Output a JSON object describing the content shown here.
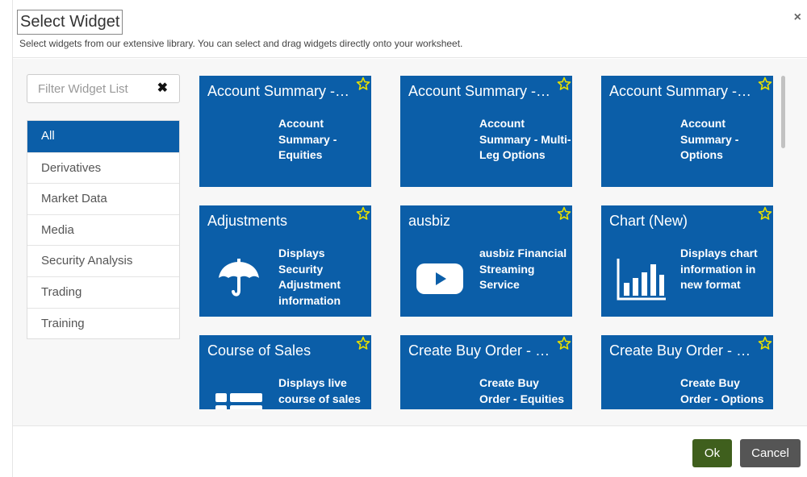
{
  "dialog": {
    "title": "Select Widget",
    "subtitle": "Select widgets from our extensive library. You can select and drag widgets directly onto your worksheet.",
    "close_glyph": "×"
  },
  "filter": {
    "placeholder": "Filter Widget List",
    "clear_glyph": "✖"
  },
  "categories": [
    {
      "label": "All",
      "active": true
    },
    {
      "label": "Derivatives"
    },
    {
      "label": "Market Data"
    },
    {
      "label": "Media"
    },
    {
      "label": "Security Analysis"
    },
    {
      "label": "Trading"
    },
    {
      "label": "Training"
    }
  ],
  "widgets": [
    {
      "title": "Account Summary - Equities",
      "desc": "Account Summary - Equities",
      "icon": "none"
    },
    {
      "title": "Account Summary - Multi-Leg Options",
      "desc": "Account Summary - Multi-Leg Options",
      "icon": "none"
    },
    {
      "title": "Account Summary - Options",
      "desc": "Account Summary - Options",
      "icon": "none"
    },
    {
      "title": "Adjustments",
      "desc": "Displays Security Adjustment information",
      "icon": "umbrella-icon"
    },
    {
      "title": "ausbiz",
      "desc": "ausbiz Financial Streaming Service",
      "icon": "youtube-play-icon"
    },
    {
      "title": "Chart (New)",
      "desc": "Displays chart information in new format",
      "icon": "bar-chart-icon"
    },
    {
      "title": "Course of Sales",
      "desc": "Displays live course of sales",
      "icon": "list-icon"
    },
    {
      "title": "Create Buy Order - Equities",
      "desc": "Create Buy Order - Equities",
      "icon": "none"
    },
    {
      "title": "Create Buy Order - Options",
      "desc": "Create Buy Order - Options",
      "icon": "none"
    }
  ],
  "colors": {
    "accent": "#0b5ea8",
    "star": "#e8e000",
    "ok_button": "#3f5f1d",
    "cancel_button": "#555555"
  },
  "footer": {
    "ok_label": "Ok",
    "cancel_label": "Cancel"
  }
}
